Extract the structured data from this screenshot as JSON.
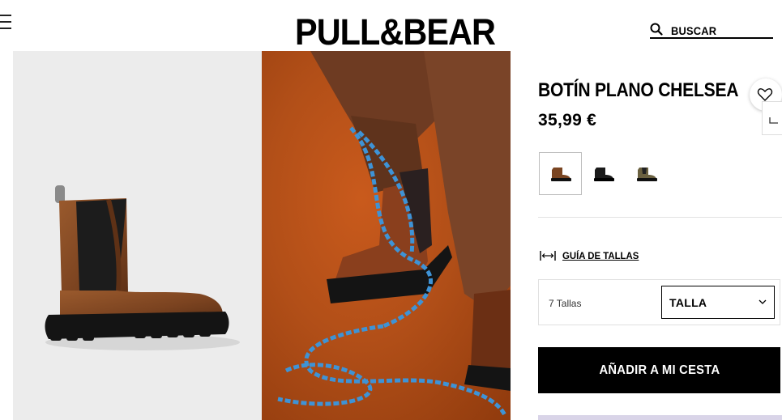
{
  "header": {
    "logo_text": "PULL&BEAR",
    "search_label": "BUSCAR"
  },
  "product": {
    "name": "BOTÍN PLANO CHELSEA",
    "price": "35,99 €",
    "colors": [
      {
        "name": "marrón",
        "selected": true,
        "hex": "#7a4522"
      },
      {
        "name": "negro",
        "selected": false,
        "hex": "#1a1a1a"
      },
      {
        "name": "caqui",
        "selected": false,
        "hex": "#6b6140"
      }
    ]
  },
  "sizes": {
    "guide_label": "GUÍA DE TALLAS",
    "count_label": "7 Tallas",
    "select_label": "TALLA"
  },
  "cart": {
    "add_label": "AÑADIR A MI CESTA"
  },
  "colors": {
    "accent": "#000000",
    "image_left_bg": "#ececec",
    "image_right_bg": "#b24f18"
  },
  "icons": [
    "menu-icon",
    "search-icon",
    "heart-icon",
    "share-icon",
    "size-guide-icon",
    "chevron-down-icon"
  ]
}
